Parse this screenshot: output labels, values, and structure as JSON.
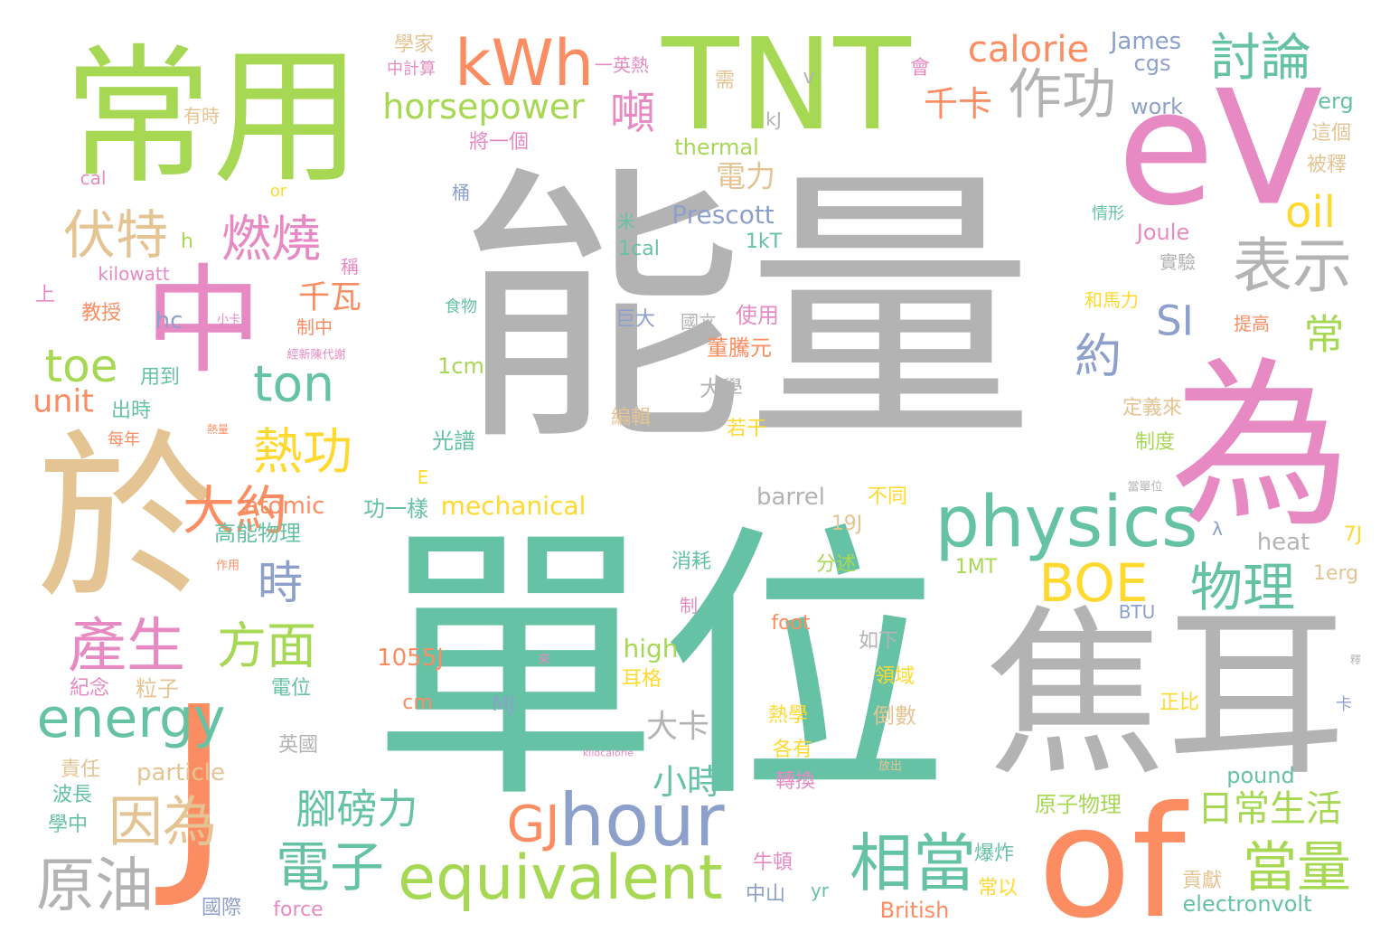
{
  "palette": {
    "gray": "#b3b3b3",
    "teal": "#66c2a5",
    "orange": "#fc8d62",
    "blue": "#8da0cb",
    "pink": "#e78ac3",
    "green": "#a6d854",
    "yellow": "#ffd92f",
    "tan": "#e5c494"
  },
  "words": [
    {
      "text": "能量",
      "color": "gray",
      "vertical": false
    },
    {
      "text": "單位",
      "color": "teal",
      "vertical": false
    },
    {
      "text": "焦耳",
      "color": "gray",
      "vertical": false
    },
    {
      "text": "TNT",
      "color": "green",
      "vertical": false
    },
    {
      "text": "常用",
      "color": "green",
      "vertical": false
    },
    {
      "text": "為",
      "color": "pink",
      "vertical": false
    },
    {
      "text": "於",
      "color": "tan",
      "vertical": false
    },
    {
      "text": "J",
      "color": "orange",
      "vertical": false
    },
    {
      "text": "eV",
      "color": "pink",
      "vertical": false
    },
    {
      "text": "of",
      "color": "orange",
      "vertical": false
    },
    {
      "text": "中",
      "color": "pink",
      "vertical": false
    },
    {
      "text": "kWh",
      "color": "orange",
      "vertical": false
    },
    {
      "text": "physics",
      "color": "teal",
      "vertical": false
    },
    {
      "text": "hour",
      "color": "blue",
      "vertical": false
    },
    {
      "text": "equivalent",
      "color": "green",
      "vertical": false
    },
    {
      "text": "相當",
      "color": "teal",
      "vertical": false
    },
    {
      "text": "當量",
      "color": "green",
      "vertical": false
    },
    {
      "text": "energy",
      "color": "teal",
      "vertical": false
    },
    {
      "text": "產生",
      "color": "pink",
      "vertical": false
    },
    {
      "text": "原油",
      "color": "gray",
      "vertical": false
    },
    {
      "text": "因為",
      "color": "tan",
      "vertical": false
    },
    {
      "text": "電子",
      "color": "teal",
      "vertical": false
    },
    {
      "text": "BOE",
      "color": "yellow",
      "vertical": false
    },
    {
      "text": "物理",
      "color": "teal",
      "vertical": false
    },
    {
      "text": "表示",
      "color": "gray",
      "vertical": false
    },
    {
      "text": "作功",
      "color": "gray",
      "vertical": false
    },
    {
      "text": "討論",
      "color": "teal",
      "vertical": false
    },
    {
      "text": "燃燒",
      "color": "pink",
      "vertical": false
    },
    {
      "text": "伏特",
      "color": "tan",
      "vertical": false
    },
    {
      "text": "熱功",
      "color": "yellow",
      "vertical": false
    },
    {
      "text": "大約",
      "color": "orange",
      "vertical": false
    },
    {
      "text": "方面",
      "color": "green",
      "vertical": false
    },
    {
      "text": "腳磅力",
      "color": "teal",
      "vertical": false
    },
    {
      "text": "ton",
      "color": "teal",
      "vertical": false
    },
    {
      "text": "toe",
      "color": "green",
      "vertical": false
    },
    {
      "text": "GJ",
      "color": "orange",
      "vertical": false
    },
    {
      "text": "日常生活",
      "color": "green",
      "vertical": false
    },
    {
      "text": "horsepower",
      "color": "green",
      "vertical": false
    },
    {
      "text": "oil",
      "color": "yellow",
      "vertical": false
    },
    {
      "text": "calorie",
      "color": "orange",
      "vertical": false
    },
    {
      "text": "SI",
      "color": "blue",
      "vertical": false
    },
    {
      "text": "約",
      "color": "blue",
      "vertical": false
    },
    {
      "text": "常",
      "color": "green",
      "vertical": false
    },
    {
      "text": "時",
      "color": "blue",
      "vertical": false
    },
    {
      "text": "小時",
      "color": "teal",
      "vertical": false
    },
    {
      "text": "噸",
      "color": "pink",
      "vertical": false
    },
    {
      "text": "千卡",
      "color": "orange",
      "vertical": false
    },
    {
      "text": "千瓦",
      "color": "orange",
      "vertical": false
    },
    {
      "text": "電力",
      "color": "tan",
      "vertical": false
    },
    {
      "text": "大卡",
      "color": "gray",
      "vertical": false
    },
    {
      "text": "unit",
      "color": "orange",
      "vertical": false
    },
    {
      "text": "James",
      "color": "blue",
      "vertical": false
    },
    {
      "text": "cgs",
      "color": "blue",
      "vertical": false
    },
    {
      "text": "work",
      "color": "blue",
      "vertical": false
    },
    {
      "text": "erg",
      "color": "teal",
      "vertical": false
    },
    {
      "text": "Prescott",
      "color": "blue",
      "vertical": false
    },
    {
      "text": "Joule",
      "color": "pink",
      "vertical": false
    },
    {
      "text": "thermal",
      "color": "green",
      "vertical": false
    },
    {
      "text": "mechanical",
      "color": "yellow",
      "vertical": false
    },
    {
      "text": "atomic",
      "color": "orange",
      "vertical": false
    },
    {
      "text": "barrel",
      "color": "gray",
      "vertical": false
    },
    {
      "text": "heat",
      "color": "gray",
      "vertical": false
    },
    {
      "text": "particle",
      "color": "tan",
      "vertical": false
    },
    {
      "text": "high",
      "color": "green",
      "vertical": false
    },
    {
      "text": "foot",
      "color": "orange",
      "vertical": false
    },
    {
      "text": "pound",
      "color": "teal",
      "vertical": false
    },
    {
      "text": "electronvolt",
      "color": "teal",
      "vertical": false
    },
    {
      "text": "British",
      "color": "orange",
      "vertical": false
    },
    {
      "text": "force",
      "color": "pink",
      "vertical": false
    },
    {
      "text": "1kT",
      "color": "teal",
      "vertical": false
    },
    {
      "text": "1cal",
      "color": "teal",
      "vertical": false
    },
    {
      "text": "1cm",
      "color": "green",
      "vertical": false
    },
    {
      "text": "1MT",
      "color": "green",
      "vertical": false
    },
    {
      "text": "19J",
      "color": "tan",
      "vertical": false
    },
    {
      "text": "7J",
      "color": "yellow",
      "vertical": false
    },
    {
      "text": "1erg",
      "color": "tan",
      "vertical": false
    },
    {
      "text": "1055J",
      "color": "orange",
      "vertical": false
    },
    {
      "text": "cm",
      "color": "orange",
      "vertical": false
    },
    {
      "text": "MJ",
      "color": "blue",
      "vertical": false
    },
    {
      "text": "hc",
      "color": "blue",
      "vertical": false
    },
    {
      "text": "BTU",
      "color": "blue",
      "vertical": false
    },
    {
      "text": "kJ",
      "color": "gray",
      "vertical": false
    },
    {
      "text": "cal",
      "color": "pink",
      "vertical": false
    },
    {
      "text": "or",
      "color": "yellow",
      "vertical": false
    },
    {
      "text": "h",
      "color": "green",
      "vertical": false
    },
    {
      "text": "v",
      "color": "gray",
      "vertical": false
    },
    {
      "text": "E",
      "color": "yellow",
      "vertical": false
    },
    {
      "text": "λ",
      "color": "blue",
      "vertical": false
    },
    {
      "text": "yr",
      "color": "teal",
      "vertical": false
    },
    {
      "text": "kilowatt",
      "color": "pink",
      "vertical": false
    },
    {
      "text": "kilocalorie",
      "color": "pink",
      "vertical": false
    },
    {
      "text": "學家",
      "color": "tan",
      "vertical": false
    },
    {
      "text": "中計算",
      "color": "pink",
      "vertical": false
    },
    {
      "text": "一英熱",
      "color": "pink",
      "vertical": false
    },
    {
      "text": "有時",
      "color": "tan",
      "vertical": false
    },
    {
      "text": "將一個",
      "color": "pink",
      "vertical": false
    },
    {
      "text": "桶",
      "color": "blue",
      "vertical": false
    },
    {
      "text": "米",
      "color": "teal",
      "vertical": false
    },
    {
      "text": "需",
      "color": "tan",
      "vertical": false
    },
    {
      "text": "會",
      "color": "pink",
      "vertical": false
    },
    {
      "text": "這個",
      "color": "tan",
      "vertical": false
    },
    {
      "text": "被釋",
      "color": "tan",
      "vertical": false
    },
    {
      "text": "情形",
      "color": "teal",
      "vertical": false
    },
    {
      "text": "實驗",
      "color": "gray",
      "vertical": false
    },
    {
      "text": "和馬力",
      "color": "yellow",
      "vertical": false
    },
    {
      "text": "提高",
      "color": "orange",
      "vertical": false
    },
    {
      "text": "定義來",
      "color": "tan",
      "vertical": false
    },
    {
      "text": "制度",
      "color": "green",
      "vertical": false
    },
    {
      "text": "上",
      "color": "pink",
      "vertical": false
    },
    {
      "text": "稱",
      "color": "pink",
      "vertical": false
    },
    {
      "text": "教授",
      "color": "orange",
      "vertical": false
    },
    {
      "text": "小卡",
      "color": "pink",
      "vertical": false
    },
    {
      "text": "食物",
      "color": "teal",
      "vertical": false
    },
    {
      "text": "制中",
      "color": "orange",
      "vertical": false
    },
    {
      "text": "經新陳代謝",
      "color": "pink",
      "vertical": false
    },
    {
      "text": "用到",
      "color": "teal",
      "vertical": false
    },
    {
      "text": "出時",
      "color": "teal",
      "vertical": false
    },
    {
      "text": "每年",
      "color": "orange",
      "vertical": false
    },
    {
      "text": "熱量",
      "color": "orange",
      "vertical": false
    },
    {
      "text": "巨大",
      "color": "blue",
      "vertical": false
    },
    {
      "text": "國立",
      "color": "gray",
      "vertical": false
    },
    {
      "text": "使用",
      "color": "pink",
      "vertical": false
    },
    {
      "text": "董騰元",
      "color": "orange",
      "vertical": false
    },
    {
      "text": "大學",
      "color": "gray",
      "vertical": false
    },
    {
      "text": "編輯",
      "color": "tan",
      "vertical": false
    },
    {
      "text": "若干",
      "color": "yellow",
      "vertical": false
    },
    {
      "text": "光譜",
      "color": "teal",
      "vertical": false
    },
    {
      "text": "高能物理",
      "color": "teal",
      "vertical": false
    },
    {
      "text": "功一樣",
      "color": "teal",
      "vertical": false
    },
    {
      "text": "不同",
      "color": "yellow",
      "vertical": false
    },
    {
      "text": "當單位",
      "color": "gray",
      "vertical": false
    },
    {
      "text": "消耗",
      "color": "teal",
      "vertical": false
    },
    {
      "text": "分述",
      "color": "green",
      "vertical": false
    },
    {
      "text": "作用",
      "color": "orange",
      "vertical": false
    },
    {
      "text": "制",
      "color": "pink",
      "vertical": false
    },
    {
      "text": "如下",
      "color": "gray",
      "vertical": false
    },
    {
      "text": "耳格",
      "color": "yellow",
      "vertical": false
    },
    {
      "text": "紀念",
      "color": "pink",
      "vertical": false
    },
    {
      "text": "粒子",
      "color": "tan",
      "vertical": false
    },
    {
      "text": "電位",
      "color": "teal",
      "vertical": false
    },
    {
      "text": "來",
      "color": "pink",
      "vertical": false
    },
    {
      "text": "領域",
      "color": "yellow",
      "vertical": false
    },
    {
      "text": "倒數",
      "color": "tan",
      "vertical": false
    },
    {
      "text": "正比",
      "color": "yellow",
      "vertical": false
    },
    {
      "text": "英國",
      "color": "gray",
      "vertical": false
    },
    {
      "text": "熱學",
      "color": "yellow",
      "vertical": false
    },
    {
      "text": "各有",
      "color": "yellow",
      "vertical": false
    },
    {
      "text": "責任",
      "color": "tan",
      "vertical": false
    },
    {
      "text": "放出",
      "color": "tan",
      "vertical": false
    },
    {
      "text": "轉換",
      "color": "pink",
      "vertical": false
    },
    {
      "text": "波長",
      "color": "teal",
      "vertical": false
    },
    {
      "text": "學中",
      "color": "teal",
      "vertical": false
    },
    {
      "text": "原子物理",
      "color": "green",
      "vertical": false
    },
    {
      "text": "爆炸",
      "color": "teal",
      "vertical": false
    },
    {
      "text": "牛頓",
      "color": "pink",
      "vertical": false
    },
    {
      "text": "常以",
      "color": "yellow",
      "vertical": false
    },
    {
      "text": "貢獻",
      "color": "tan",
      "vertical": false
    },
    {
      "text": "中山",
      "color": "blue",
      "vertical": false
    },
    {
      "text": "國際",
      "color": "blue",
      "vertical": false
    },
    {
      "text": "釋",
      "color": "gray",
      "vertical": false
    },
    {
      "text": "卡",
      "color": "blue",
      "vertical": false
    }
  ]
}
